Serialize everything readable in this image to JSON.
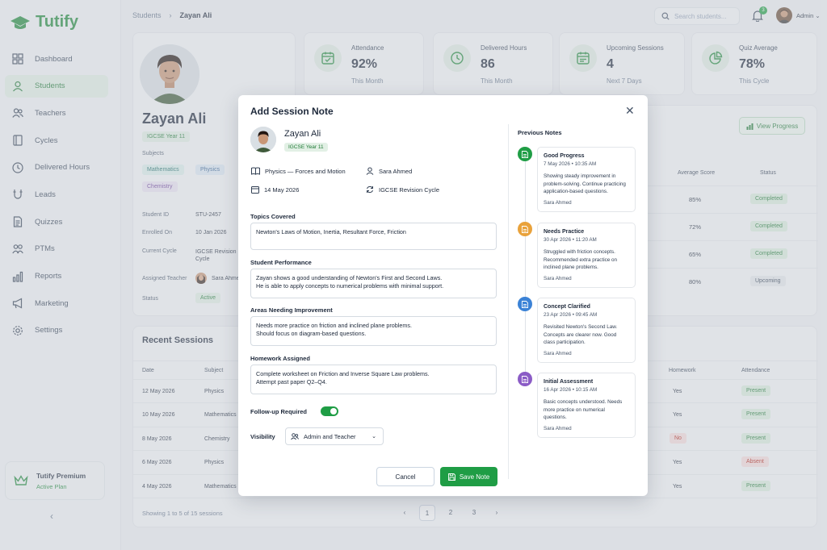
{
  "app": {
    "name": "Tutify"
  },
  "sidebar": {
    "items": [
      {
        "label": "Dashboard",
        "icon": "dashboard-icon"
      },
      {
        "label": "Students",
        "icon": "user-icon",
        "active": true
      },
      {
        "label": "Teachers",
        "icon": "users-icon"
      },
      {
        "label": "Cycles",
        "icon": "book-icon"
      },
      {
        "label": "Delivered Hours",
        "icon": "clock-icon"
      },
      {
        "label": "Leads",
        "icon": "magnet-icon"
      },
      {
        "label": "Quizzes",
        "icon": "document-icon"
      },
      {
        "label": "PTMs",
        "icon": "people-icon"
      },
      {
        "label": "Reports",
        "icon": "bar-chart-icon"
      },
      {
        "label": "Marketing",
        "icon": "megaphone-icon"
      },
      {
        "label": "Settings",
        "icon": "gear-icon"
      }
    ],
    "premium": {
      "title": "Tutify Premium",
      "subtitle": "Active Plan"
    }
  },
  "header": {
    "breadcrumb": [
      "Students",
      "Zayan Ali"
    ],
    "search_placeholder": "Search students...",
    "notifications": "3",
    "user": "Admin"
  },
  "profile": {
    "name": "Zayan Ali",
    "grade": "IGCSE Year 11",
    "subjects_label": "Subjects",
    "subjects": [
      "Mathematics",
      "Physics",
      "Chemistry"
    ],
    "fields": [
      {
        "label": "Student ID",
        "value": "STU-2457"
      },
      {
        "label": "Enrolled On",
        "value": "10 Jan 2026"
      },
      {
        "label": "Current Cycle",
        "value": "IGCSE Revision Cycle"
      },
      {
        "label": "Assigned Teacher",
        "value": "Sara Ahmed"
      },
      {
        "label": "Status",
        "value": "Active"
      }
    ]
  },
  "stats": [
    {
      "label": "Attendance",
      "value": "92%",
      "sub": "This Month",
      "icon": "calendar-check-icon"
    },
    {
      "label": "Delivered Hours",
      "value": "86",
      "sub": "This Month",
      "icon": "clock-icon"
    },
    {
      "label": "Upcoming Sessions",
      "value": "4",
      "sub": "Next 7 Days",
      "icon": "calendar-icon"
    },
    {
      "label": "Quiz Average",
      "value": "78%",
      "sub": "This Cycle",
      "icon": "pie-chart-icon"
    }
  ],
  "progress": {
    "button": "View Progress",
    "headers": {
      "score": "Average Score",
      "status": "Status"
    },
    "rows": [
      {
        "score": "85%",
        "status": "Completed",
        "kind": "ok"
      },
      {
        "score": "72%",
        "status": "Completed",
        "kind": "ok"
      },
      {
        "score": "65%",
        "status": "Completed",
        "kind": "ok"
      },
      {
        "score": "80%",
        "status": "Upcoming",
        "kind": "up"
      }
    ]
  },
  "sessions": {
    "title": "Recent Sessions",
    "headers": {
      "date": "Date",
      "subject": "Subject",
      "homework": "Homework",
      "attendance": "Attendance"
    },
    "rows": [
      {
        "date": "12 May 2026",
        "subject": "Physics",
        "homework": "Yes",
        "attendance": "Present",
        "hw_kind": "",
        "att_kind": "ok"
      },
      {
        "date": "10 May 2026",
        "subject": "Mathematics",
        "homework": "Yes",
        "attendance": "Present",
        "hw_kind": "",
        "att_kind": "ok"
      },
      {
        "date": "8 May 2026",
        "subject": "Chemistry",
        "homework": "No",
        "attendance": "Present",
        "hw_kind": "no",
        "att_kind": "ok"
      },
      {
        "date": "6 May 2026",
        "subject": "Physics",
        "homework": "Yes",
        "attendance": "Absent",
        "hw_kind": "",
        "att_kind": "no"
      },
      {
        "date": "4 May 2026",
        "subject": "Mathematics",
        "homework": "Yes",
        "attendance": "Present",
        "hw_kind": "",
        "att_kind": "ok"
      }
    ],
    "footer": "Showing 1 to 5 of 15 sessions",
    "pages": [
      "1",
      "2",
      "3"
    ],
    "current_page": "1"
  },
  "modal": {
    "title": "Add Session Note",
    "student": {
      "name": "Zayan Ali",
      "grade": "IGCSE Year 11"
    },
    "subject": "Physics — Forces and Motion",
    "teacher": "Sara Ahmed",
    "date": "14 May 2026",
    "cycle": "IGCSE Revision Cycle",
    "topics": {
      "label": "Topics Covered",
      "value": "Newton's Laws of Motion, Inertia, Resultant Force, Friction"
    },
    "performance": {
      "label": "Student Performance",
      "value": "Zayan shows a good understanding of Newton's First and Second Laws.\nHe is able to apply concepts to numerical problems with minimal support."
    },
    "improvement": {
      "label": "Areas Needing Improvement",
      "value": "Needs more practice on friction and inclined plane problems.\nShould focus on diagram-based questions."
    },
    "homework": {
      "label": "Homework Assigned",
      "value": "Complete worksheet on Friction and Inverse Square Law problems.\nAttempt past paper Q2–Q4."
    },
    "followup": {
      "label": "Follow-up Required",
      "on": true
    },
    "visibility": {
      "label": "Visibility",
      "value": "Admin and Teacher"
    },
    "cancel": "Cancel",
    "save": "Save Note",
    "previous_title": "Previous Notes",
    "notes": [
      {
        "title": "Good Progress",
        "date": "7 May 2026  •  10:35 AM",
        "text": "Showing steady improvement in problem-solving. Continue practicing application-based questions.",
        "author": "Sara Ahmed",
        "color": "#1f9d45"
      },
      {
        "title": "Needs Practice",
        "date": "30 Apr 2026  •  11:20 AM",
        "text": "Struggled with friction concepts. Recommended extra practice on inclined plane problems.",
        "author": "Sara Ahmed",
        "color": "#e9a23b"
      },
      {
        "title": "Concept Clarified",
        "date": "23 Apr 2026  •  09:45 AM",
        "text": "Revisited Newton's Second Law. Concepts are clearer now. Good class participation.",
        "author": "Sara Ahmed",
        "color": "#3b82d6"
      },
      {
        "title": "Initial Assessment",
        "date": "16 Apr 2026  •  10:15 AM",
        "text": "Basic concepts understood. Needs more practice on numerical questions.",
        "author": "Sara Ahmed",
        "color": "#8b5cc6"
      }
    ]
  }
}
